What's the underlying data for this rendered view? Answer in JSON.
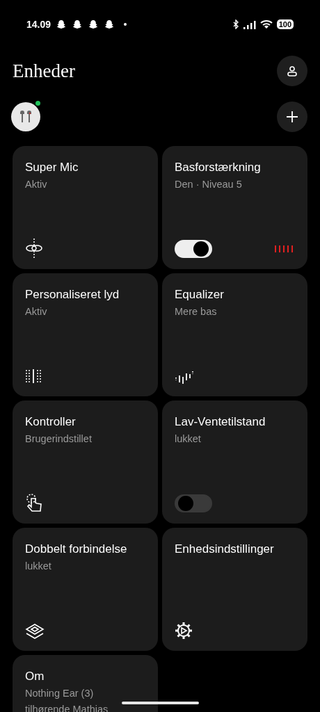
{
  "status_bar": {
    "time": "14.09",
    "notifications": [
      {
        "kind": "snap"
      },
      {
        "kind": "snap"
      },
      {
        "kind": "snap"
      },
      {
        "kind": "snap"
      }
    ],
    "battery": "100"
  },
  "header": {
    "title": "Enheder"
  },
  "device": {
    "connected": true
  },
  "cards": [
    {
      "kind": "icon",
      "title": "Super Mic",
      "subtitle": "Aktiv"
    },
    {
      "kind": "toggle",
      "title": "Basforstærkning",
      "subtitle": "Den · Niveau 5",
      "on": true,
      "bars": true
    },
    {
      "kind": "icon",
      "title": "Personaliseret lyd",
      "subtitle": "Aktiv"
    },
    {
      "kind": "icon",
      "title": "Equalizer",
      "subtitle": "Mere bas"
    },
    {
      "kind": "icon",
      "title": "Kontroller",
      "subtitle": "Brugerindstillet"
    },
    {
      "kind": "toggle",
      "title": "Lav-Ventetilstand",
      "subtitle": "lukket",
      "on": false,
      "bars": false
    },
    {
      "kind": "icon",
      "title": "Dobbelt forbindelse",
      "subtitle": "lukket"
    },
    {
      "kind": "icon",
      "title": "Enhedsindstillinger"
    },
    {
      "kind": "info",
      "title": "Om",
      "lines": [
        "Nothing Ear (3)",
        "tilhørende Mathias"
      ]
    }
  ]
}
